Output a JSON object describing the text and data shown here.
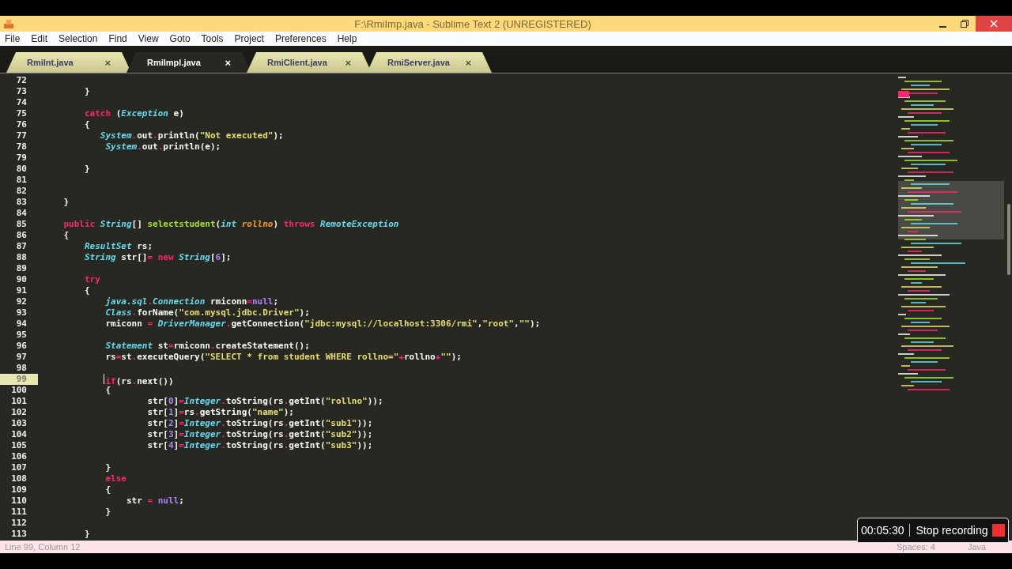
{
  "window": {
    "title": "F:\\RmiImp.java - Sublime Text 2 (UNREGISTERED)"
  },
  "menu": [
    "File",
    "Edit",
    "Selection",
    "Find",
    "View",
    "Goto",
    "Tools",
    "Project",
    "Preferences",
    "Help"
  ],
  "tabs": [
    {
      "label": "RmiInt.java",
      "selected": false,
      "close": "×"
    },
    {
      "label": "RmiImpl.java",
      "selected": true,
      "close": "×"
    },
    {
      "label": "RmiClient.java",
      "selected": false,
      "close": "×"
    },
    {
      "label": "RmiServer.java",
      "selected": false,
      "close": "×"
    }
  ],
  "editor": {
    "lines": [
      {
        "number": "72",
        "current": false
      },
      {
        "number": "73",
        "current": false,
        "tokens": [
          {
            "kind": "plain",
            "text": "        }"
          }
        ]
      },
      {
        "number": "74",
        "current": false
      },
      {
        "number": "75",
        "current": false,
        "tokens": [
          {
            "kind": "keyword",
            "text": "        catch"
          },
          {
            "kind": "plain",
            "text": " ("
          },
          {
            "kind": "type",
            "text": "Exception"
          },
          {
            "kind": "plain",
            "text": " e)"
          }
        ]
      },
      {
        "number": "76",
        "current": false,
        "tokens": [
          {
            "kind": "plain",
            "text": "        {"
          }
        ]
      },
      {
        "number": "77",
        "current": false,
        "tokens": [
          {
            "kind": "type",
            "text": "           System"
          },
          {
            "kind": "op",
            "text": "."
          },
          {
            "kind": "plain",
            "text": "out"
          },
          {
            "kind": "op",
            "text": "."
          },
          {
            "kind": "plain",
            "text": "println("
          },
          {
            "kind": "string",
            "text": "\"Not executed\""
          },
          {
            "kind": "plain",
            "text": ");"
          }
        ]
      },
      {
        "number": "78",
        "current": false,
        "tokens": [
          {
            "kind": "type",
            "text": "            System"
          },
          {
            "kind": "op",
            "text": "."
          },
          {
            "kind": "plain",
            "text": "out"
          },
          {
            "kind": "op",
            "text": "."
          },
          {
            "kind": "plain",
            "text": "println(e);"
          }
        ]
      },
      {
        "number": "79",
        "current": false
      },
      {
        "number": "80",
        "current": false,
        "tokens": [
          {
            "kind": "plain",
            "text": "        }"
          }
        ]
      },
      {
        "number": "81",
        "current": false
      },
      {
        "number": "82",
        "current": false
      },
      {
        "number": "83",
        "current": false,
        "tokens": [
          {
            "kind": "plain",
            "text": "    }"
          }
        ]
      },
      {
        "number": "84",
        "current": false
      },
      {
        "number": "85",
        "current": false,
        "tokens": [
          {
            "kind": "keyword",
            "text": "    public"
          },
          {
            "kind": "type",
            "text": " String"
          },
          {
            "kind": "plain",
            "text": "[] "
          },
          {
            "kind": "func",
            "text": "selectstudent"
          },
          {
            "kind": "plain",
            "text": "("
          },
          {
            "kind": "type",
            "text": "int"
          },
          {
            "kind": "param",
            "text": " rollno"
          },
          {
            "kind": "plain",
            "text": ") "
          },
          {
            "kind": "keyword",
            "text": "throws"
          },
          {
            "kind": "type",
            "text": " RemoteException"
          }
        ]
      },
      {
        "number": "86",
        "current": false,
        "tokens": [
          {
            "kind": "plain",
            "text": "    {"
          }
        ]
      },
      {
        "number": "87",
        "current": false,
        "tokens": [
          {
            "kind": "type",
            "text": "        ResultSet"
          },
          {
            "kind": "plain",
            "text": " rs;"
          }
        ]
      },
      {
        "number": "88",
        "current": false,
        "tokens": [
          {
            "kind": "type",
            "text": "        String"
          },
          {
            "kind": "plain",
            "text": " str[]"
          },
          {
            "kind": "op",
            "text": "="
          },
          {
            "kind": "keyword",
            "text": " new"
          },
          {
            "kind": "type",
            "text": " String"
          },
          {
            "kind": "plain",
            "text": "["
          },
          {
            "kind": "number",
            "text": "6"
          },
          {
            "kind": "plain",
            "text": "];"
          }
        ]
      },
      {
        "number": "89",
        "current": false
      },
      {
        "number": "90",
        "current": false,
        "tokens": [
          {
            "kind": "keyword",
            "text": "        try"
          }
        ]
      },
      {
        "number": "91",
        "current": false,
        "tokens": [
          {
            "kind": "plain",
            "text": "        {"
          }
        ]
      },
      {
        "number": "92",
        "current": false,
        "tokens": [
          {
            "kind": "type",
            "text": "            java.sql"
          },
          {
            "kind": "op",
            "text": "."
          },
          {
            "kind": "type",
            "text": "Connection"
          },
          {
            "kind": "plain",
            "text": " rmiconn"
          },
          {
            "kind": "op",
            "text": "="
          },
          {
            "kind": "number",
            "text": "null"
          },
          {
            "kind": "plain",
            "text": ";"
          }
        ]
      },
      {
        "number": "93",
        "current": false,
        "tokens": [
          {
            "kind": "type",
            "text": "            Class"
          },
          {
            "kind": "op",
            "text": "."
          },
          {
            "kind": "plain",
            "text": "forName("
          },
          {
            "kind": "string",
            "text": "\"com.mysql.jdbc.Driver\""
          },
          {
            "kind": "plain",
            "text": ");"
          }
        ]
      },
      {
        "number": "94",
        "current": false,
        "tokens": [
          {
            "kind": "plain",
            "text": "            rmiconn "
          },
          {
            "kind": "op",
            "text": "="
          },
          {
            "kind": "type",
            "text": " DriverManager"
          },
          {
            "kind": "op",
            "text": "."
          },
          {
            "kind": "plain",
            "text": "getConnection("
          },
          {
            "kind": "string",
            "text": "\"jdbc:mysql://localhost:3306/rmi\""
          },
          {
            "kind": "plain",
            "text": ","
          },
          {
            "kind": "string",
            "text": "\"root\""
          },
          {
            "kind": "plain",
            "text": ","
          },
          {
            "kind": "string",
            "text": "\"\""
          },
          {
            "kind": "plain",
            "text": ");"
          }
        ]
      },
      {
        "number": "95",
        "current": false
      },
      {
        "number": "96",
        "current": false,
        "tokens": [
          {
            "kind": "type",
            "text": "            Statement"
          },
          {
            "kind": "plain",
            "text": " st"
          },
          {
            "kind": "op",
            "text": "="
          },
          {
            "kind": "plain",
            "text": "rmiconn"
          },
          {
            "kind": "op",
            "text": "."
          },
          {
            "kind": "plain",
            "text": "createStatement();"
          }
        ]
      },
      {
        "number": "97",
        "current": false,
        "tokens": [
          {
            "kind": "plain",
            "text": "            rs"
          },
          {
            "kind": "op",
            "text": "="
          },
          {
            "kind": "plain",
            "text": "st"
          },
          {
            "kind": "op",
            "text": "."
          },
          {
            "kind": "plain",
            "text": "executeQuery("
          },
          {
            "kind": "string",
            "text": "\"SELECT * from student WHERE rollno=\""
          },
          {
            "kind": "op",
            "text": "+"
          },
          {
            "kind": "plain",
            "text": "rollno"
          },
          {
            "kind": "op",
            "text": "+"
          },
          {
            "kind": "string",
            "text": "\"\""
          },
          {
            "kind": "plain",
            "text": ");"
          }
        ]
      },
      {
        "number": "98",
        "current": false
      },
      {
        "number": "99",
        "current": true,
        "tokens": [
          {
            "kind": "keyword",
            "text": "            if"
          },
          {
            "kind": "plain",
            "text": "(rs"
          },
          {
            "kind": "op",
            "text": "."
          },
          {
            "kind": "plain",
            "text": "next())"
          }
        ]
      },
      {
        "number": "100",
        "current": false,
        "tokens": [
          {
            "kind": "plain",
            "text": "            {"
          }
        ]
      },
      {
        "number": "101",
        "current": false,
        "tokens": [
          {
            "kind": "plain",
            "text": "                    str["
          },
          {
            "kind": "number",
            "text": "0"
          },
          {
            "kind": "plain",
            "text": "]"
          },
          {
            "kind": "op",
            "text": "="
          },
          {
            "kind": "type",
            "text": "Integer"
          },
          {
            "kind": "op",
            "text": "."
          },
          {
            "kind": "plain",
            "text": "toString(rs"
          },
          {
            "kind": "op",
            "text": "."
          },
          {
            "kind": "plain",
            "text": "getInt("
          },
          {
            "kind": "string",
            "text": "\"rollno\""
          },
          {
            "kind": "plain",
            "text": "));"
          }
        ]
      },
      {
        "number": "102",
        "current": false,
        "tokens": [
          {
            "kind": "plain",
            "text": "                    str["
          },
          {
            "kind": "number",
            "text": "1"
          },
          {
            "kind": "plain",
            "text": "]"
          },
          {
            "kind": "op",
            "text": "="
          },
          {
            "kind": "plain",
            "text": "rs"
          },
          {
            "kind": "op",
            "text": "."
          },
          {
            "kind": "plain",
            "text": "getString("
          },
          {
            "kind": "string",
            "text": "\"name\""
          },
          {
            "kind": "plain",
            "text": ");"
          }
        ]
      },
      {
        "number": "103",
        "current": false,
        "tokens": [
          {
            "kind": "plain",
            "text": "                    str["
          },
          {
            "kind": "number",
            "text": "2"
          },
          {
            "kind": "plain",
            "text": "]"
          },
          {
            "kind": "op",
            "text": "="
          },
          {
            "kind": "type",
            "text": "Integer"
          },
          {
            "kind": "op",
            "text": "."
          },
          {
            "kind": "plain",
            "text": "toString(rs"
          },
          {
            "kind": "op",
            "text": "."
          },
          {
            "kind": "plain",
            "text": "getInt("
          },
          {
            "kind": "string",
            "text": "\"sub1\""
          },
          {
            "kind": "plain",
            "text": "));"
          }
        ]
      },
      {
        "number": "104",
        "current": false,
        "tokens": [
          {
            "kind": "plain",
            "text": "                    str["
          },
          {
            "kind": "number",
            "text": "3"
          },
          {
            "kind": "plain",
            "text": "]"
          },
          {
            "kind": "op",
            "text": "="
          },
          {
            "kind": "type",
            "text": "Integer"
          },
          {
            "kind": "op",
            "text": "."
          },
          {
            "kind": "plain",
            "text": "toString(rs"
          },
          {
            "kind": "op",
            "text": "."
          },
          {
            "kind": "plain",
            "text": "getInt("
          },
          {
            "kind": "string",
            "text": "\"sub2\""
          },
          {
            "kind": "plain",
            "text": "));"
          }
        ]
      },
      {
        "number": "105",
        "current": false,
        "tokens": [
          {
            "kind": "plain",
            "text": "                    str["
          },
          {
            "kind": "number",
            "text": "4"
          },
          {
            "kind": "plain",
            "text": "]"
          },
          {
            "kind": "op",
            "text": "="
          },
          {
            "kind": "type",
            "text": "Integer"
          },
          {
            "kind": "op",
            "text": "."
          },
          {
            "kind": "plain",
            "text": "toString(rs"
          },
          {
            "kind": "op",
            "text": "."
          },
          {
            "kind": "plain",
            "text": "getInt("
          },
          {
            "kind": "string",
            "text": "\"sub3\""
          },
          {
            "kind": "plain",
            "text": "));"
          }
        ]
      },
      {
        "number": "106",
        "current": false
      },
      {
        "number": "107",
        "current": false,
        "tokens": [
          {
            "kind": "plain",
            "text": "            }"
          }
        ]
      },
      {
        "number": "108",
        "current": false,
        "tokens": [
          {
            "kind": "keyword",
            "text": "            else"
          }
        ]
      },
      {
        "number": "109",
        "current": false,
        "tokens": [
          {
            "kind": "plain",
            "text": "            {"
          }
        ]
      },
      {
        "number": "110",
        "current": false,
        "tokens": [
          {
            "kind": "plain",
            "text": "                str "
          },
          {
            "kind": "op",
            "text": "="
          },
          {
            "kind": "number",
            "text": " null"
          },
          {
            "kind": "plain",
            "text": ";"
          }
        ]
      },
      {
        "number": "111",
        "current": false,
        "tokens": [
          {
            "kind": "plain",
            "text": "            }"
          }
        ]
      },
      {
        "number": "112",
        "current": false
      },
      {
        "number": "113",
        "current": false,
        "tokens": [
          {
            "kind": "plain",
            "text": "        }"
          }
        ]
      }
    ]
  },
  "status_bar": {
    "position": "Line 99, Column 12",
    "indentation": "Spaces: 4",
    "syntax": "Java"
  },
  "recording": {
    "time": "00:05:30",
    "label": "Stop recording"
  }
}
